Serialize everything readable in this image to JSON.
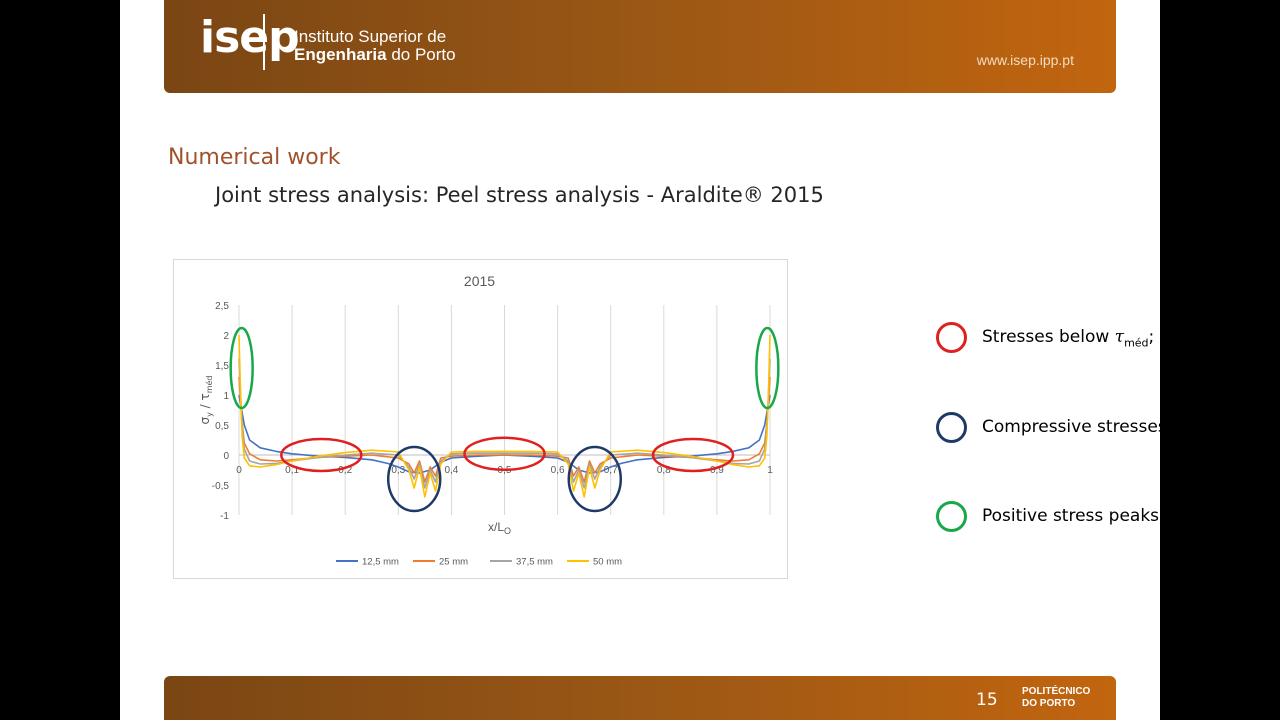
{
  "header": {
    "logo_text": "isep",
    "institution_line1": "Instituto Superior de",
    "institution_line2_bold": "Engenharia",
    "institution_line2_rest": " do Porto",
    "website": "www.isep.ipp.pt"
  },
  "section_title": "Numerical work",
  "subtitle": "Joint stress analysis: Peel stress analysis - Araldite® 2015",
  "chart_data": {
    "type": "line",
    "title": "2015",
    "xlabel_main": "x/L",
    "xlabel_sub": "O",
    "ylabel_main": "σ",
    "ylabel_sub": "y",
    "ylabel_den": "τ",
    "ylabel_den_sub": "méd",
    "xlim": [
      0,
      1
    ],
    "ylim": [
      -1,
      2.5
    ],
    "x_ticks": [
      "0",
      "0,1",
      "0,2",
      "0,3",
      "0,4",
      "0,5",
      "0,6",
      "0,7",
      "0,8",
      "0,9",
      "1"
    ],
    "y_ticks": [
      "2,5",
      "2",
      "1,5",
      "1",
      "0,5",
      "0",
      "-0,5",
      "-1"
    ],
    "grid": "vertical",
    "legend_position": "bottom",
    "series": [
      {
        "name": "12,5 mm",
        "color": "#4472c4",
        "x": [
          0,
          0.01,
          0.02,
          0.04,
          0.07,
          0.1,
          0.15,
          0.2,
          0.25,
          0.28,
          0.3,
          0.32,
          0.34,
          0.36,
          0.38,
          0.4,
          0.45,
          0.5,
          0.55,
          0.6,
          0.62,
          0.64,
          0.66,
          0.68,
          0.7,
          0.72,
          0.75,
          0.8,
          0.85,
          0.9,
          0.93,
          0.96,
          0.98,
          0.99,
          1
        ],
        "y": [
          1.0,
          0.5,
          0.25,
          0.12,
          0.06,
          0.02,
          -0.02,
          -0.04,
          -0.08,
          -0.14,
          -0.2,
          -0.28,
          -0.3,
          -0.25,
          -0.12,
          -0.05,
          -0.02,
          0.0,
          -0.02,
          -0.05,
          -0.12,
          -0.25,
          -0.3,
          -0.28,
          -0.2,
          -0.14,
          -0.08,
          -0.04,
          -0.02,
          0.02,
          0.06,
          0.12,
          0.25,
          0.5,
          1.0
        ]
      },
      {
        "name": "25 mm",
        "color": "#ed7d31",
        "x": [
          0,
          0.005,
          0.01,
          0.02,
          0.04,
          0.07,
          0.1,
          0.15,
          0.2,
          0.25,
          0.3,
          0.32,
          0.33,
          0.34,
          0.35,
          0.36,
          0.37,
          0.38,
          0.4,
          0.45,
          0.5,
          0.55,
          0.6,
          0.62,
          0.63,
          0.64,
          0.65,
          0.66,
          0.67,
          0.68,
          0.7,
          0.75,
          0.8,
          0.85,
          0.9,
          0.93,
          0.96,
          0.98,
          0.99,
          0.995,
          1
        ],
        "y": [
          1.3,
          0.6,
          0.2,
          0.02,
          -0.08,
          -0.1,
          -0.08,
          -0.04,
          -0.02,
          0.0,
          -0.05,
          -0.15,
          -0.3,
          -0.1,
          -0.45,
          -0.2,
          -0.35,
          -0.05,
          -0.02,
          0.0,
          0.0,
          0.0,
          -0.02,
          -0.05,
          -0.35,
          -0.2,
          -0.45,
          -0.1,
          -0.3,
          -0.15,
          -0.05,
          0.0,
          -0.02,
          -0.04,
          -0.08,
          -0.1,
          -0.08,
          0.02,
          0.2,
          0.6,
          1.3
        ]
      },
      {
        "name": "37,5 mm",
        "color": "#a5a5a5",
        "x": [
          0,
          0.005,
          0.01,
          0.02,
          0.04,
          0.07,
          0.1,
          0.15,
          0.2,
          0.25,
          0.3,
          0.32,
          0.33,
          0.34,
          0.35,
          0.36,
          0.37,
          0.38,
          0.4,
          0.45,
          0.5,
          0.55,
          0.6,
          0.62,
          0.63,
          0.64,
          0.65,
          0.66,
          0.67,
          0.68,
          0.7,
          0.75,
          0.8,
          0.85,
          0.9,
          0.93,
          0.96,
          0.98,
          0.99,
          0.995,
          1
        ],
        "y": [
          1.6,
          0.6,
          0.1,
          -0.1,
          -0.15,
          -0.14,
          -0.1,
          -0.04,
          0.0,
          0.03,
          0.0,
          -0.2,
          -0.4,
          -0.15,
          -0.55,
          -0.25,
          -0.45,
          -0.1,
          0.02,
          0.03,
          0.03,
          0.03,
          0.02,
          -0.1,
          -0.45,
          -0.25,
          -0.55,
          -0.15,
          -0.4,
          -0.2,
          0.0,
          0.03,
          0.0,
          -0.04,
          -0.1,
          -0.14,
          -0.15,
          -0.1,
          0.1,
          0.6,
          1.6
        ]
      },
      {
        "name": "50 mm",
        "color": "#ffc000",
        "x": [
          0,
          0.003,
          0.006,
          0.01,
          0.02,
          0.04,
          0.07,
          0.1,
          0.15,
          0.2,
          0.25,
          0.3,
          0.32,
          0.33,
          0.34,
          0.35,
          0.36,
          0.37,
          0.38,
          0.4,
          0.45,
          0.5,
          0.55,
          0.6,
          0.62,
          0.63,
          0.64,
          0.65,
          0.66,
          0.67,
          0.68,
          0.7,
          0.75,
          0.8,
          0.85,
          0.9,
          0.93,
          0.96,
          0.98,
          0.99,
          0.994,
          0.997,
          1
        ],
        "y": [
          2.0,
          1.0,
          0.3,
          -0.05,
          -0.18,
          -0.2,
          -0.16,
          -0.1,
          -0.02,
          0.04,
          0.08,
          0.05,
          -0.25,
          -0.55,
          -0.2,
          -0.7,
          -0.3,
          -0.6,
          -0.15,
          0.05,
          0.06,
          0.06,
          0.06,
          0.05,
          -0.15,
          -0.6,
          -0.3,
          -0.7,
          -0.2,
          -0.55,
          -0.25,
          0.05,
          0.08,
          0.04,
          -0.02,
          -0.1,
          -0.16,
          -0.2,
          -0.18,
          -0.05,
          0.3,
          1.0,
          2.0
        ]
      }
    ]
  },
  "legend_items": [
    {
      "label": "Stresses below ",
      "tau": "τ",
      "tau_sub": "méd",
      "suffix": ";",
      "color": "#e02020"
    },
    {
      "label": "Compressive stresses;",
      "color": "#1f3a68"
    },
    {
      "label": "Positive stress peaks.",
      "color": "#18a84a"
    }
  ],
  "footer": {
    "page_number": "15",
    "brand_line1": "POLITÉCNICO",
    "brand_line2": "DO PORTO"
  }
}
